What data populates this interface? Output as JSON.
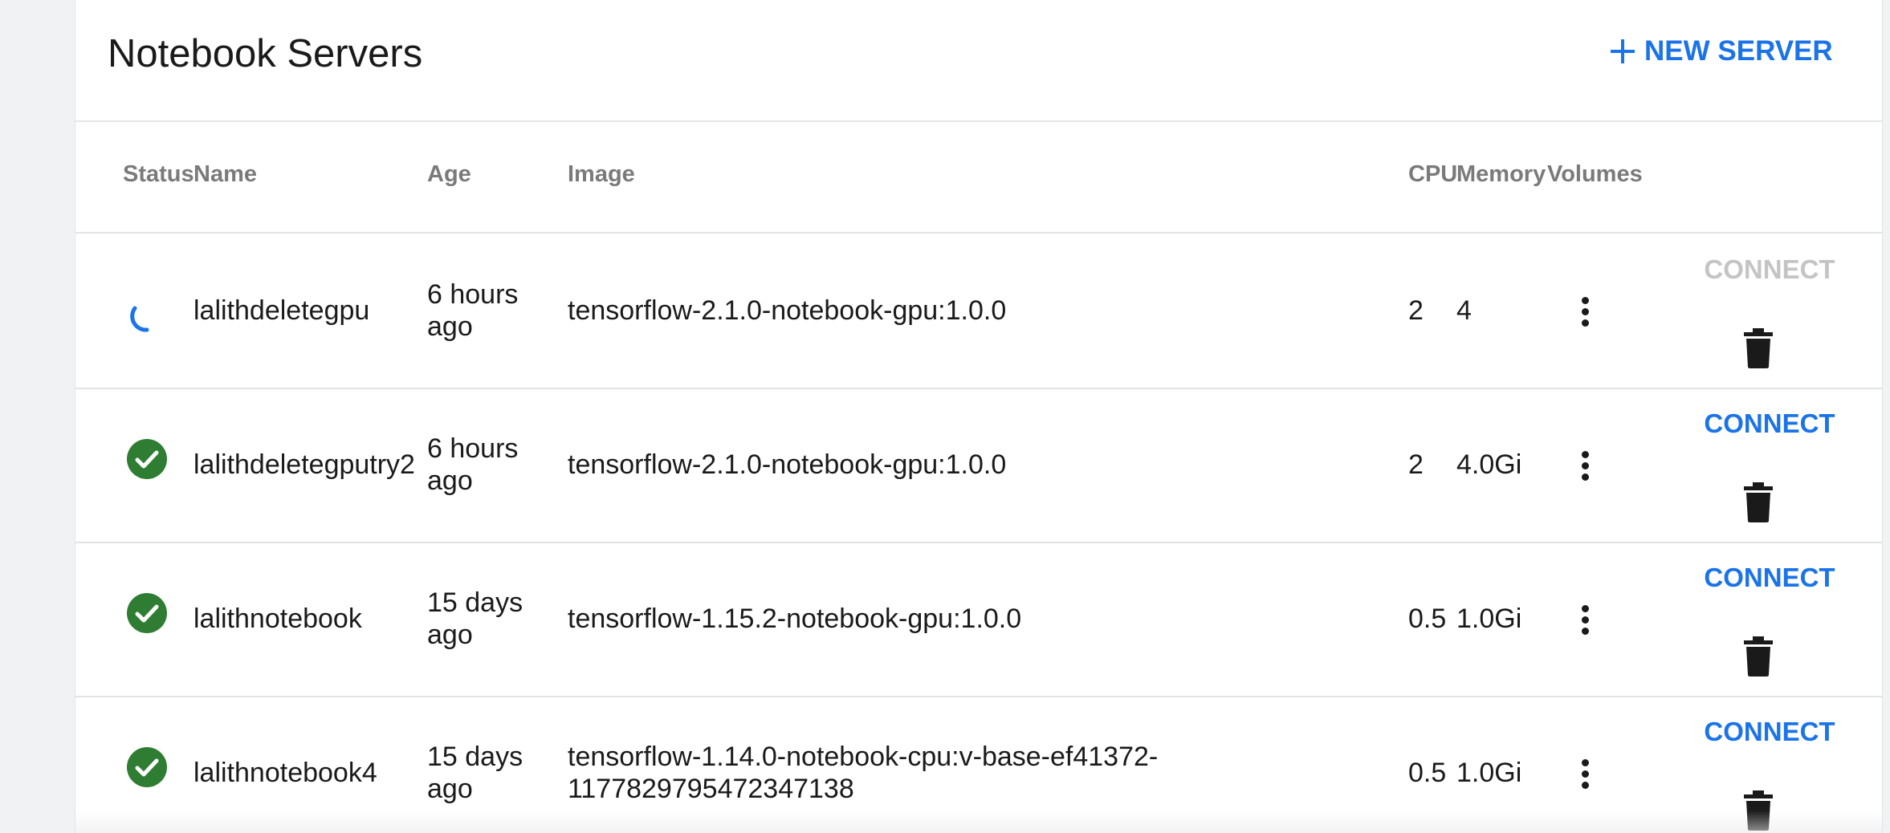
{
  "header": {
    "title": "Notebook Servers",
    "new_server_label": "NEW SERVER"
  },
  "columns": {
    "status": "Status",
    "name": "Name",
    "age": "Age",
    "image": "Image",
    "cpu": "CPU",
    "memory": "Memory",
    "volumes": "Volumes"
  },
  "rows": [
    {
      "status": "loading",
      "name": "lalithdeletegpu",
      "age_line1": "6 hours",
      "age_line2": "ago",
      "image_line1": "tensorflow-2.1.0-notebook-gpu:1.0.0",
      "image_line2": "",
      "cpu": "2",
      "memory": "4",
      "connect_label": "CONNECT",
      "connect_enabled": false
    },
    {
      "status": "ready",
      "name": "lalithdeletegputry2",
      "age_line1": "6 hours",
      "age_line2": "ago",
      "image_line1": "tensorflow-2.1.0-notebook-gpu:1.0.0",
      "image_line2": "",
      "cpu": "2",
      "memory": "4.0Gi",
      "connect_label": "CONNECT",
      "connect_enabled": true
    },
    {
      "status": "ready",
      "name": "lalithnotebook",
      "age_line1": "15 days",
      "age_line2": "ago",
      "image_line1": "tensorflow-1.15.2-notebook-gpu:1.0.0",
      "image_line2": "",
      "cpu": "0.5",
      "memory": "1.0Gi",
      "connect_label": "CONNECT",
      "connect_enabled": true
    },
    {
      "status": "ready",
      "name": "lalithnotebook4",
      "age_line1": "15 days",
      "age_line2": "ago",
      "image_line1": "tensorflow-1.14.0-notebook-cpu:v-base-ef41372-",
      "image_line2": "1177829795472347138",
      "cpu": "0.5",
      "memory": "1.0Gi",
      "connect_label": "CONNECT",
      "connect_enabled": true
    }
  ],
  "colors": {
    "accent": "#1a73e8",
    "success": "#2e7d32",
    "disabled": "#c4c4c4"
  },
  "icons": {
    "new_server": "plus-icon",
    "status_ready": "check-circle-icon",
    "status_loading": "spinner-icon",
    "more": "more-vert-icon",
    "delete": "trash-icon"
  }
}
